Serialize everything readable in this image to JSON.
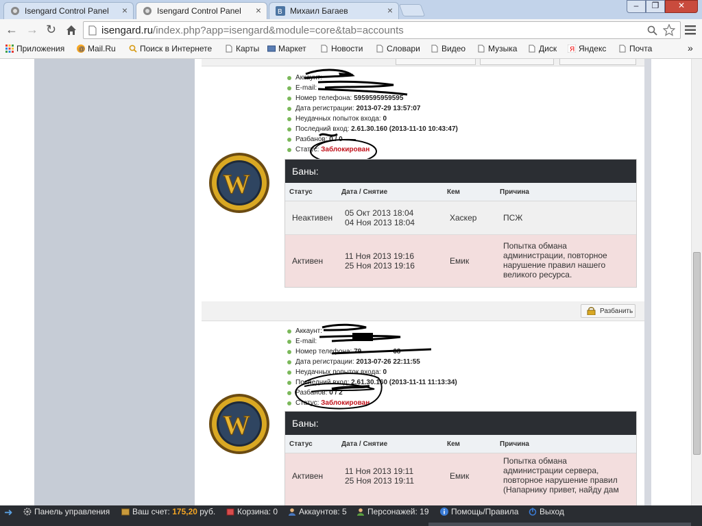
{
  "browser": {
    "tabs": [
      {
        "label": "Isengard Control Panel",
        "active": false
      },
      {
        "label": "Isengard Control Panel",
        "active": true
      },
      {
        "label": "Михаил Багаев",
        "active": false
      }
    ],
    "close_glyph": "×",
    "url_host": "isengard.ru",
    "url_rest": "/index.php?app=isengard&module=core&tab=accounts",
    "window_buttons": {
      "minimize": "–",
      "maximize": "❐",
      "close": "✕"
    },
    "bookmarks": [
      "Приложения",
      "Mail.Ru",
      "Поиск в Интернете",
      "Карты",
      "Маркет",
      "Новости",
      "Словари",
      "Видео",
      "Музыка",
      "Диск",
      "Яндекс",
      "Почта"
    ],
    "bookmarks_more": "»"
  },
  "accounts": [
    {
      "info": {
        "account_label": "Аккаунт:",
        "email_label": "E-mail:",
        "phone_label": "Номер телефона:",
        "phone_value": "5959595959595",
        "reg_label": "Дата регистрации:",
        "reg_value": "2013-07-29 13:57:07",
        "failed_label": "Неудачных попыток входа:",
        "failed_value": "0",
        "last_label": "Последний вход:",
        "last_value": "2.61.30.160 (2013-11-10 10:43:47)",
        "unban_label": "Разбанов:",
        "unban_value": "0 / 0",
        "status_label": "Статус:",
        "status_value": "Заблокирован"
      },
      "bans": {
        "title": "Баны:",
        "columns": [
          "Статус",
          "Дата / Снятие",
          "Кем",
          "Причина"
        ],
        "rows": [
          {
            "status": "Неактивен",
            "date": "05 Окт 2013 18:04",
            "until": "04 Ноя 2013 18:04",
            "by": "Хаскер",
            "reason": [
              "ПСЖ"
            ]
          },
          {
            "status": "Активен",
            "date": "11 Ноя 2013 19:16",
            "until": "25 Ноя 2013 19:16",
            "by": "Емик",
            "reason": [
              "Попытка обмана",
              "администрации, повторное",
              "нарушение правил нашего",
              "великого ресурса."
            ]
          }
        ]
      }
    },
    {
      "unban_button": "Разбанить",
      "info": {
        "account_label": "Аккаунт:",
        "email_label": "E-mail:",
        "phone_label": "Номер телефона:",
        "phone_value": "79",
        "phone_tail": "68",
        "reg_label": "Дата регистрации:",
        "reg_value": "2013-07-26 22:11:55",
        "failed_label": "Неудачных попыток входа:",
        "failed_value": "0",
        "last_label": "Последний вход:",
        "last_value": "2.61.30.160 (2013-11-11 11:13:34)",
        "unban_label": "Разбанов:",
        "unban_value": "0 / 2",
        "status_label": "Статус:",
        "status_value": "Заблокирован"
      },
      "bans": {
        "title": "Баны:",
        "columns": [
          "Статус",
          "Дата / Снятие",
          "Кем",
          "Причина"
        ],
        "rows": [
          {
            "status": "Активен",
            "date": "11 Ноя 2013 19:11",
            "until": "25 Ноя 2013 19:11",
            "by": "Емик",
            "reason": [
              "Попытка обмана",
              "администрации сервера,",
              "повторное нарушение правил",
              "(Напарнику привет, найду дам"
            ]
          }
        ]
      }
    }
  ],
  "bottombar": {
    "panel": "Панель управления",
    "balance_label": "Ваш счет:",
    "balance_value": "175,20",
    "balance_unit": "руб.",
    "cart": "Корзина: 0",
    "accounts": "Аккаунтов: 5",
    "characters": "Персонажей: 19",
    "help": "Помощь/Правила",
    "logout": "Выход"
  },
  "colors": {
    "blocked": "#c0121b",
    "balance": "#f5a623",
    "bar": "#2a2d32",
    "ban_active_row": "#f3dede"
  }
}
